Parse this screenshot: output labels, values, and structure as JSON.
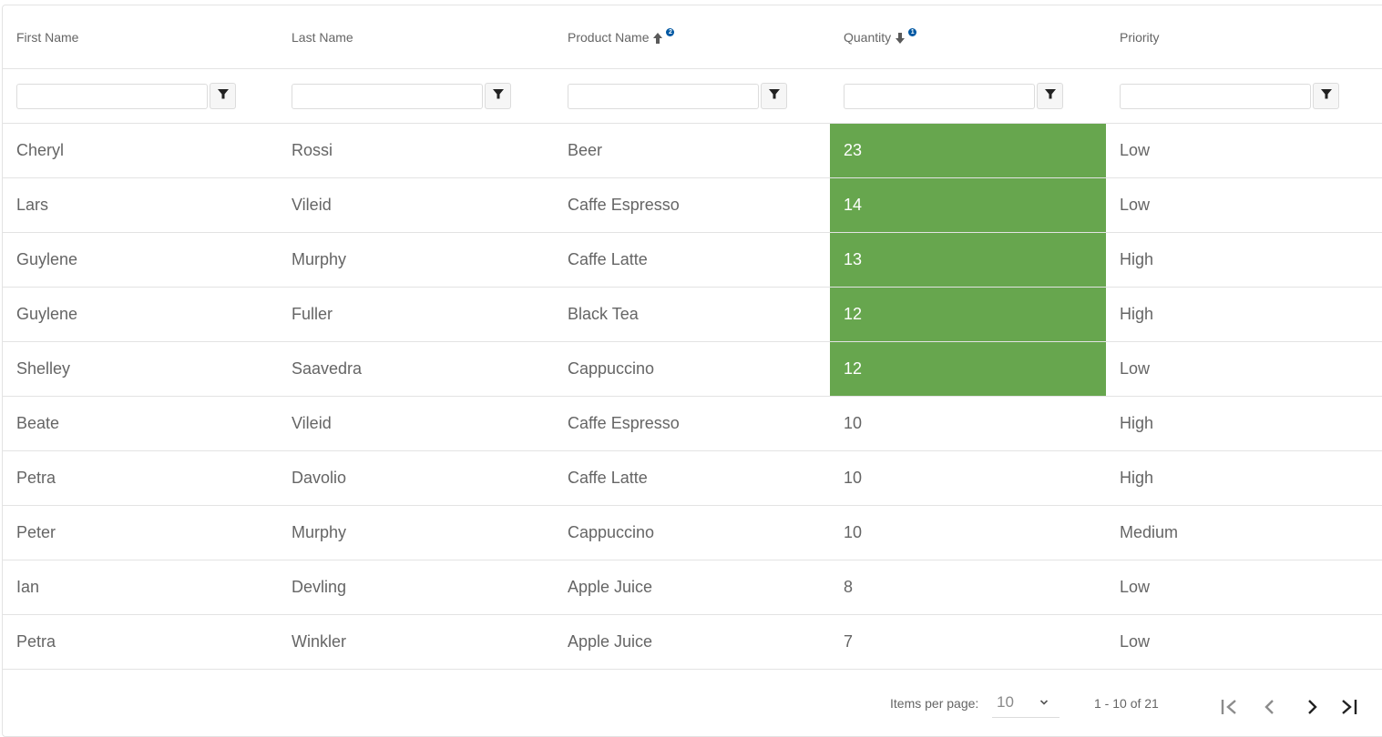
{
  "grid": {
    "columns": [
      {
        "label": "First Name",
        "sort": null,
        "sort_index": null
      },
      {
        "label": "Last Name",
        "sort": null,
        "sort_index": null
      },
      {
        "label": "Product Name",
        "sort": "ascending",
        "sort_index": "2"
      },
      {
        "label": "Quantity",
        "sort": "descending",
        "sort_index": "1"
      },
      {
        "label": "Priority",
        "sort": null,
        "sort_index": null
      }
    ],
    "filters": [
      {
        "value": "",
        "icon": "filter-icon"
      },
      {
        "value": "",
        "icon": "filter-icon"
      },
      {
        "value": "",
        "icon": "filter-icon"
      },
      {
        "value": "",
        "icon": "filter-icon"
      },
      {
        "value": "",
        "icon": "filter-icon"
      }
    ],
    "highlight_color": "#67a64e",
    "rows": [
      {
        "first": "Cheryl",
        "last": "Rossi",
        "product": "Beer",
        "qty": "23",
        "priority": "Low",
        "highlight": true
      },
      {
        "first": "Lars",
        "last": "Vileid",
        "product": "Caffe Espresso",
        "qty": "14",
        "priority": "Low",
        "highlight": true
      },
      {
        "first": "Guylene",
        "last": "Murphy",
        "product": "Caffe Latte",
        "qty": "13",
        "priority": "High",
        "highlight": true
      },
      {
        "first": "Guylene",
        "last": "Fuller",
        "product": "Black Tea",
        "qty": "12",
        "priority": "High",
        "highlight": true
      },
      {
        "first": "Shelley",
        "last": "Saavedra",
        "product": "Cappuccino",
        "qty": "12",
        "priority": "Low",
        "highlight": true
      },
      {
        "first": "Beate",
        "last": "Vileid",
        "product": "Caffe Espresso",
        "qty": "10",
        "priority": "High",
        "highlight": false
      },
      {
        "first": "Petra",
        "last": "Davolio",
        "product": "Caffe Latte",
        "qty": "10",
        "priority": "High",
        "highlight": false
      },
      {
        "first": "Peter",
        "last": "Murphy",
        "product": "Cappuccino",
        "qty": "10",
        "priority": "Medium",
        "highlight": false
      },
      {
        "first": "Ian",
        "last": "Devling",
        "product": "Apple Juice",
        "qty": "8",
        "priority": "Low",
        "highlight": false
      },
      {
        "first": "Petra",
        "last": "Winkler",
        "product": "Apple Juice",
        "qty": "7",
        "priority": "Low",
        "highlight": false
      }
    ]
  },
  "pager": {
    "items_per_page_label": "Items per page:",
    "items_per_page_value": "10",
    "range_label": "1 - 10 of 21",
    "first_icon": "first-page-icon",
    "prev_icon": "prev-page-icon",
    "next_icon": "next-page-icon",
    "last_icon": "last-page-icon"
  }
}
